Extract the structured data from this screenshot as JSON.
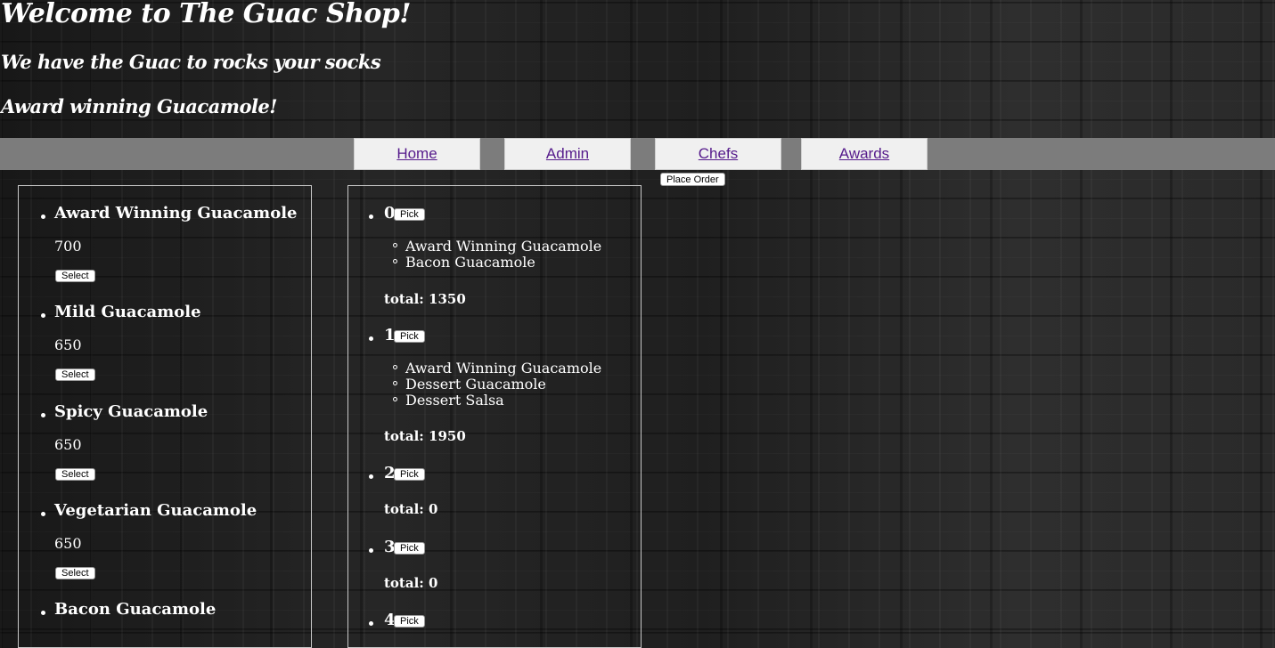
{
  "header": {
    "title": "Welcome to The Guac Shop!",
    "tagline": "We have the Guac to rocks your socks",
    "subtitle": "Award winning Guacamole!"
  },
  "nav": {
    "home": "Home",
    "admin": "Admin",
    "chefs": "Chefs",
    "awards": "Awards"
  },
  "place_order_label": "Place Order",
  "menu": {
    "select_label": "Select",
    "items": [
      {
        "name": "Award Winning Guacamole",
        "price": "700"
      },
      {
        "name": "Mild Guacamole",
        "price": "650"
      },
      {
        "name": "Spicy Guacamole",
        "price": "650"
      },
      {
        "name": "Vegetarian Guacamole",
        "price": "650"
      },
      {
        "name": "Bacon Guacamole",
        "price": ""
      }
    ]
  },
  "orders": {
    "pick_label": "Pick",
    "list": [
      {
        "number": "0",
        "items": [
          "Award Winning Guacamole",
          "Bacon Guacamole"
        ],
        "total": "total: 1350"
      },
      {
        "number": "1",
        "items": [
          "Award Winning Guacamole",
          "Dessert Guacamole",
          "Dessert Salsa"
        ],
        "total": "total: 1950"
      },
      {
        "number": "2",
        "items": [],
        "total": "total: 0"
      },
      {
        "number": "3",
        "items": [],
        "total": "total: 0"
      },
      {
        "number": "4",
        "items": [],
        "total": ""
      }
    ]
  },
  "colors": {
    "nav_bar": "#7c7c7c",
    "nav_button": "#f0f0f0",
    "link": "#551a8b",
    "text": "#ffffff"
  }
}
